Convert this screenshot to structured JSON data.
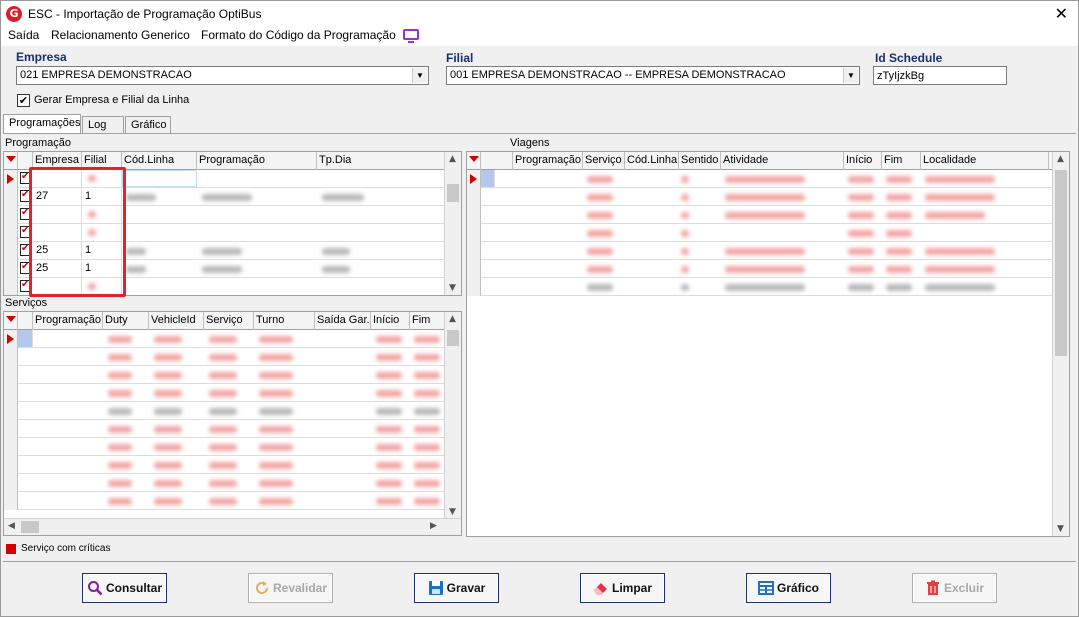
{
  "window": {
    "title": "ESC - Importação de Programação OptiBus",
    "app_icon_letter": "G",
    "close_symbol": "✕"
  },
  "menu": {
    "items": [
      "Saída",
      "Relacionamento Generico",
      "Formato do Código da Programação"
    ]
  },
  "form": {
    "empresa_label": "Empresa",
    "empresa_value": "021 EMPRESA DEMONSTRACAO",
    "filial_label": "Filial",
    "filial_value": "001 EMPRESA DEMONSTRACAO -- EMPRESA DEMONSTRACAO",
    "id_schedule_label": "Id Schedule",
    "id_schedule_value": "zTyIjzkBg",
    "gerar_checkbox_label": "Gerar Empresa e Filial da Linha",
    "gerar_checked": true
  },
  "tabs": [
    {
      "label": "Programações",
      "active": true
    },
    {
      "label": "Log",
      "active": false
    },
    {
      "label": "Gráfico",
      "active": false
    }
  ],
  "programacao": {
    "section_label": "Programação",
    "columns": [
      "Empresa",
      "Filial",
      "Cód.Linha",
      "Programação",
      "Tp.Dia"
    ],
    "rows": [
      {
        "empresa": "",
        "filial": ""
      },
      {
        "empresa": "27",
        "filial": "1"
      },
      {
        "empresa": "",
        "filial": ""
      },
      {
        "empresa": "",
        "filial": ""
      },
      {
        "empresa": "25",
        "filial": "1"
      },
      {
        "empresa": "25",
        "filial": "1"
      },
      {
        "empresa": "",
        "filial": ""
      }
    ]
  },
  "servicos": {
    "section_label": "Serviços",
    "columns": [
      "Programação",
      "Duty",
      "VehicleId",
      "Serviço",
      "Turno",
      "Saída Gar.",
      "Início",
      "Fim"
    ]
  },
  "viagens": {
    "section_label": "Viagens",
    "columns": [
      "Programação",
      "Serviço",
      "Cód.Linha",
      "Sentido",
      "Atividade",
      "Início",
      "Fim",
      "Localidade"
    ]
  },
  "legend": {
    "text": "Serviço com críticas",
    "color": "#d00000"
  },
  "buttons": {
    "consultar": "Consultar",
    "revalidar": "Revalidar",
    "gravar": "Gravar",
    "limpar": "Limpar",
    "grafico": "Gráfico",
    "excluir": "Excluir"
  },
  "icons": [
    "search-icon",
    "refresh-icon",
    "save-icon",
    "eraser-icon",
    "chart-icon",
    "trash-icon",
    "monitor-icon"
  ]
}
